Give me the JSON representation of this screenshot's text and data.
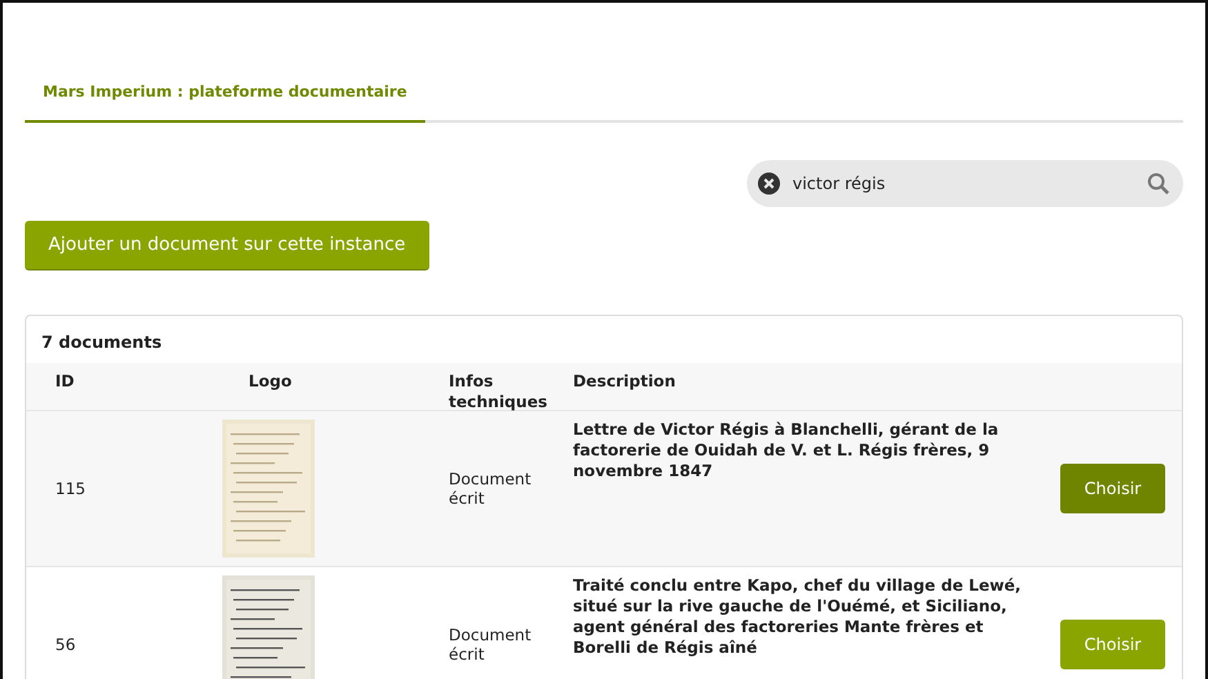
{
  "tabs": [
    {
      "label": "Mars Imperium : plateforme documentaire",
      "selected": true
    }
  ],
  "search": {
    "value": "victor régis"
  },
  "add_button": "Ajouter un document sur cette instance",
  "table": {
    "count": "7 documents",
    "columns": [
      "ID",
      "Logo",
      "Infos techniques",
      "Description"
    ],
    "rows": [
      {
        "id": "115",
        "infos": "Document écrit",
        "description": "Lettre de Victor Régis à Blanchelli, gérant de la factorerie de Ouidah de V. et L. Régis frères, 9 novembre 1847",
        "action": "Choisir",
        "highlighted": true
      },
      {
        "id": "56",
        "infos": "Document écrit",
        "description": "Traité conclu entre Kapo, chef du village de Lewé, situé sur la rive gauche de l'Ouémé, et Siciliano, agent général des factoreries Mante frères et Borelli de Régis aîné",
        "action": "Choisir",
        "highlighted": false
      }
    ]
  }
}
